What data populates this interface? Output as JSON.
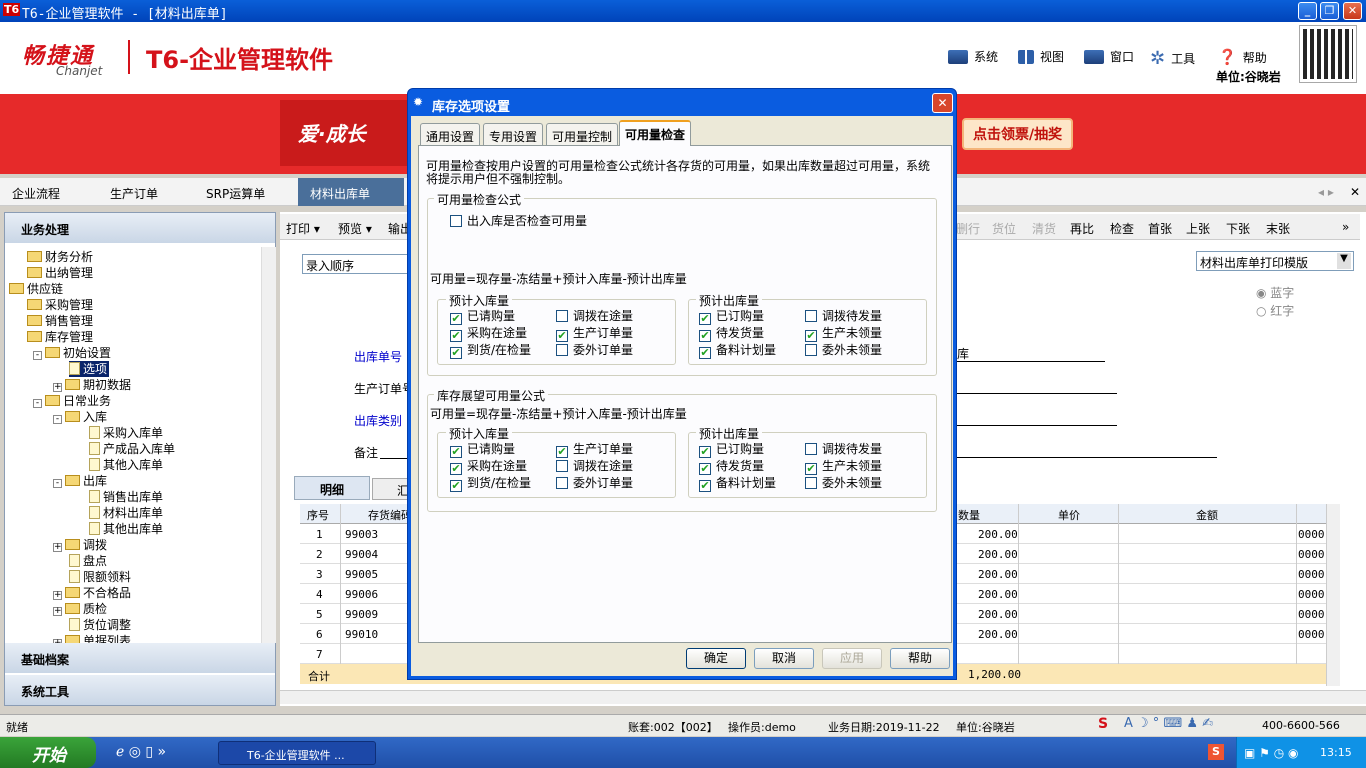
{
  "window": {
    "title": "T6-企业管理软件 - [材料出库单]",
    "icon": "T6"
  },
  "brand": {
    "logo_cn": "畅捷通",
    "logo_en": "Chanjet",
    "product": "T6-企业管理软件"
  },
  "menu": [
    {
      "label": "系统"
    },
    {
      "label": "视图"
    },
    {
      "label": "窗口"
    },
    {
      "label": "工具"
    },
    {
      "label": "帮助"
    }
  ],
  "unit_label": "单位:谷晓岩",
  "promo": {
    "slogan": "爱·成长",
    "button": "点击领票/抽奖"
  },
  "tabs": [
    "企业流程",
    "生产订单",
    "SRP运算单",
    "材料出库单"
  ],
  "left": {
    "header": "业务处理",
    "footer1": "基础档案",
    "footer2": "系统工具",
    "tree": [
      "财务分析",
      "出纳管理",
      "供应链",
      "采购管理",
      "销售管理",
      "库存管理",
      "初始设置",
      "选项",
      "期初数据",
      "日常业务",
      "入库",
      "采购入库单",
      "产成品入库单",
      "其他入库单",
      "出库",
      "销售出库单",
      "材料出库单",
      "其他出库单",
      "调拨",
      "盘点",
      "限额领料",
      "不合格品",
      "质检",
      "货位调整",
      "单据列表"
    ]
  },
  "toolbar": {
    "left": [
      "打印",
      "预览",
      "输出"
    ],
    "right": [
      "删行",
      "货位",
      "清货",
      "再比",
      "检查",
      "首张",
      "上张",
      "下张",
      "末张"
    ]
  },
  "form": {
    "order_label": "录入顺序",
    "template": "材料出库单打印模版",
    "blue": "蓝字",
    "red": "红字",
    "f1": "出库单号",
    "f2": "生产订单号",
    "f3": "出库类别",
    "f4": "备注",
    "f_right": "库",
    "tab1": "明细",
    "tab2": "汇"
  },
  "grid": {
    "headers": [
      "序号",
      "存货编码",
      "数量",
      "单价",
      "金额"
    ],
    "rows": [
      [
        "1",
        "99003",
        "200.00",
        "0000"
      ],
      [
        "2",
        "99004",
        "200.00",
        "0000"
      ],
      [
        "3",
        "99005",
        "200.00",
        "0000"
      ],
      [
        "4",
        "99006",
        "200.00",
        "0000"
      ],
      [
        "5",
        "99009",
        "200.00",
        "0000"
      ],
      [
        "6",
        "99010",
        "200.00",
        "0000"
      ],
      [
        "7",
        "",
        "",
        ""
      ]
    ],
    "total_label": "合计",
    "total_qty": "1,200.00"
  },
  "status": {
    "ready": "就绪",
    "account": "账套:002【002】",
    "operator": "操作员:demo",
    "date": "业务日期:2019-11-22",
    "unit": "单位:谷晓岩",
    "phone": "400-6600-566"
  },
  "taskbar": {
    "start": "开始",
    "item": "T6-企业管理软件 ...",
    "clock": "13:15"
  },
  "dialog": {
    "title": "库存选项设置",
    "tabs": [
      "通用设置",
      "专用设置",
      "可用量控制",
      "可用量检查"
    ],
    "desc": "可用量检查按用户设置的可用量检查公式统计各存货的可用量，如果出库数量超过可用量，系统将提示用户但不强制控制。",
    "g1": {
      "title": "可用量检查公式",
      "check_label": "出入库是否检查可用量",
      "check": false,
      "formula": "可用量=现存量-冻结量+预计入库量-预计出库量",
      "in_title": "预计入库量",
      "out_title": "预计出库量",
      "in": [
        {
          "l": "已请购量",
          "c": true
        },
        {
          "l": "调拨在途量",
          "c": false
        },
        {
          "l": "采购在途量",
          "c": true
        },
        {
          "l": "生产订单量",
          "c": true
        },
        {
          "l": "到货/在检量",
          "c": true
        },
        {
          "l": "委外订单量",
          "c": false
        }
      ],
      "out": [
        {
          "l": "已订购量",
          "c": true
        },
        {
          "l": "调拨待发量",
          "c": false
        },
        {
          "l": "待发货量",
          "c": true
        },
        {
          "l": "生产未领量",
          "c": true
        },
        {
          "l": "备料计划量",
          "c": true
        },
        {
          "l": "委外未领量",
          "c": false
        }
      ]
    },
    "g2": {
      "title": "库存展望可用量公式",
      "formula": "可用量=现存量-冻结量+预计入库量-预计出库量",
      "in_title": "预计入库量",
      "out_title": "预计出库量",
      "in": [
        {
          "l": "已请购量",
          "c": true
        },
        {
          "l": "生产订单量",
          "c": true
        },
        {
          "l": "采购在途量",
          "c": true
        },
        {
          "l": "调拨在途量",
          "c": false
        },
        {
          "l": "到货/在检量",
          "c": true
        },
        {
          "l": "委外订单量",
          "c": false
        }
      ],
      "out": [
        {
          "l": "已订购量",
          "c": true
        },
        {
          "l": "调拨待发量",
          "c": false
        },
        {
          "l": "待发货量",
          "c": true
        },
        {
          "l": "生产未领量",
          "c": true
        },
        {
          "l": "备料计划量",
          "c": true
        },
        {
          "l": "委外未领量",
          "c": false
        }
      ]
    },
    "buttons": {
      "ok": "确定",
      "cancel": "取消",
      "apply": "应用",
      "help": "帮助"
    }
  }
}
